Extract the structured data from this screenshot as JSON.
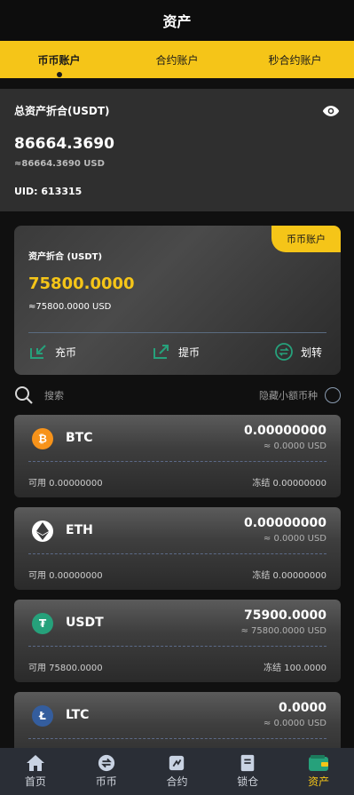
{
  "header": {
    "title": "资产"
  },
  "tabs": [
    {
      "label": "币币账户",
      "active": true
    },
    {
      "label": "合约账户",
      "active": false
    },
    {
      "label": "秒合约账户",
      "active": false
    }
  ],
  "summary": {
    "label": "总资产折合(USDT)",
    "total": "86664.3690",
    "total_usd": "≈86664.3690 USD",
    "uid": "UID: 613315"
  },
  "account_card": {
    "badge": "币币账户",
    "label": "资产折合 (USDT)",
    "value": "75800.0000",
    "value_usd": "≈75800.0000 USD",
    "actions": {
      "deposit": "充币",
      "withdraw": "提币",
      "transfer": "划转"
    }
  },
  "search": {
    "placeholder": "搜索",
    "hide_small": "隐藏小额币种"
  },
  "coins": [
    {
      "symbol": "BTC",
      "amount": "0.00000000",
      "usd": "≈ 0.0000 USD",
      "available": "可用  0.00000000",
      "frozen": "冻结  0.00000000",
      "color": "#f7931a",
      "icon": "bitcoin-icon"
    },
    {
      "symbol": "ETH",
      "amount": "0.00000000",
      "usd": "≈ 0.0000 USD",
      "available": "可用  0.00000000",
      "frozen": "冻结  0.00000000",
      "color": "#ffffff",
      "icon": "ethereum-icon"
    },
    {
      "symbol": "USDT",
      "amount": "75900.0000",
      "usd": "≈ 75800.0000 USD",
      "available": "可用  75800.0000",
      "frozen": "冻结  100.0000",
      "color": "#26a17b",
      "icon": "tether-icon"
    },
    {
      "symbol": "LTC",
      "amount": "0.0000",
      "usd": "≈ 0.0000 USD",
      "available": "",
      "frozen": "",
      "color": "#345d9d",
      "icon": "litecoin-icon"
    }
  ],
  "nav": [
    {
      "label": "首页",
      "icon": "home-icon",
      "active": false
    },
    {
      "label": "币币",
      "icon": "exchange-icon",
      "active": false
    },
    {
      "label": "合约",
      "icon": "contract-icon",
      "active": false
    },
    {
      "label": "锁仓",
      "icon": "lock-position-icon",
      "active": false
    },
    {
      "label": "资产",
      "icon": "wallet-icon",
      "active": true
    }
  ],
  "colors": {
    "accent": "#f5c518",
    "background": "#101010",
    "panel": "#2f2f2f"
  }
}
